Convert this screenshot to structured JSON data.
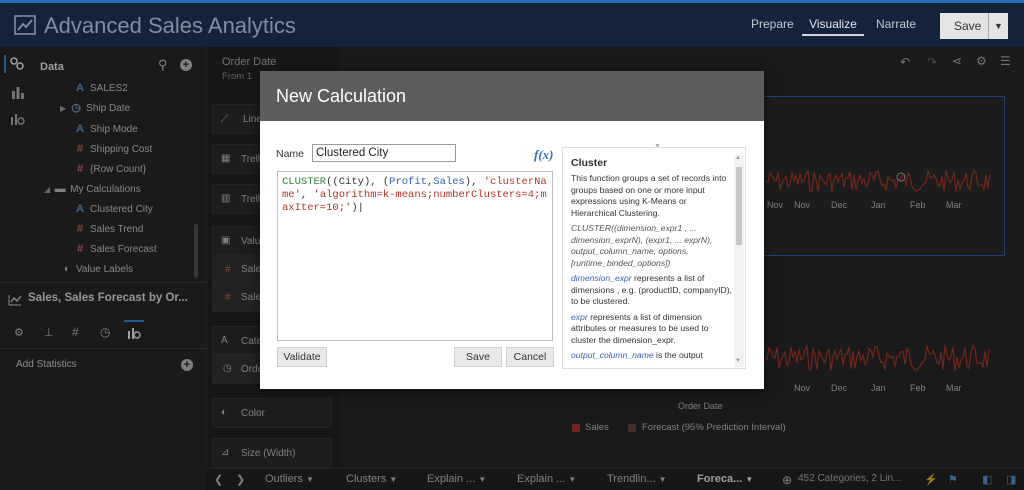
{
  "header": {
    "app_title": "Advanced Sales Analytics",
    "nav": [
      "Prepare",
      "Visualize",
      "Narrate"
    ],
    "save_label": "Save"
  },
  "left_panel": {
    "data_label": "Data",
    "tree": [
      {
        "glyph": "A",
        "label": "SALES2"
      },
      {
        "glyph": "clock",
        "label": "Ship Date"
      },
      {
        "glyph": "A",
        "label": "Ship Mode"
      },
      {
        "glyph": "#",
        "label": "Shipping Cost"
      },
      {
        "glyph": "#",
        "label": "{Row Count}"
      },
      {
        "glyph": "folder",
        "label": "My Calculations"
      },
      {
        "glyph": "A",
        "label": "Clustered City"
      },
      {
        "glyph": "#",
        "label": "Sales Trend"
      },
      {
        "glyph": "#",
        "label": "Sales Forecast"
      },
      {
        "glyph": "tag",
        "label": "Value Labels"
      }
    ],
    "viz_title": "Sales, Sales Forecast by Or...",
    "add_statistics": "Add Statistics"
  },
  "mid_panel": {
    "header": "Order Date",
    "sub": "From 1",
    "rows": [
      "Line",
      "Trell",
      "Trell",
      "Value",
      "Sale",
      "Sale",
      "Cate",
      "Orde",
      "Color",
      "Size (Width)"
    ]
  },
  "chart": {
    "months_top": [
      "Nov",
      "Dec",
      "Jan",
      "Feb",
      "Mar"
    ],
    "months_bottom": [
      "Nov",
      "Dec",
      "Jan",
      "Feb",
      "Mar"
    ],
    "x_title": "Order Date",
    "legend": [
      "Sales",
      "Forecast (95% Prediction Interval)"
    ],
    "series_color": "#b8402a"
  },
  "bottom_bar": {
    "tabs": [
      "Outliers",
      "Clusters",
      "Explain ...",
      "Explain ...",
      "Trendlin...",
      "Foreca..."
    ],
    "status": "452 Categories, 2 Lin..."
  },
  "dialog": {
    "title": "New Calculation",
    "name_label": "Name",
    "name_value": "Clustered City",
    "fx_label": "f(x)",
    "expression": {
      "fn": "CLUSTER",
      "open": "((",
      "dim": "City",
      "mid": "), (",
      "m1": "Profit",
      "comma": ",",
      "m2": "Sales",
      "close": "),",
      "s1": "'clusterName'",
      "sep": ", ",
      "s2": "'algorithm=k-means;numberClusters=4;maxIter=10;'",
      "end": ")"
    },
    "validate_label": "Validate",
    "save_label": "Save",
    "cancel_label": "Cancel",
    "help": {
      "title": "Cluster",
      "p1": "This function groups a set of records into groups based on one or more input expressions using K-Means or Hierarchical Clustering.",
      "p2": "CLUSTER((dimension_expr1 , ... dimension_exprN), (expr1, ... exprN), output_column_name, options, [runtime_binded_options])",
      "p3_link": "dimension_expr",
      "p3": " represents a list of dimensions , e.g. (productID, companyID), to be clustered.",
      "p4_link": "expr",
      "p4": " represents a list of dimension attributes or measures to be used to cluster the dimension_expr.",
      "p5_link": "output_column_name",
      "p5": " is the output"
    }
  }
}
